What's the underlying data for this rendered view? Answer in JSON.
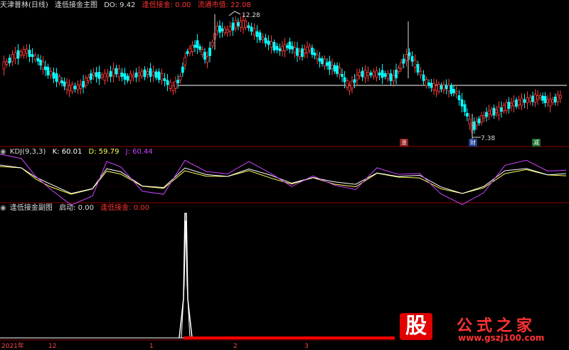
{
  "main_header": {
    "title": "天津普林(日线)",
    "indicator": "逢低接金主图",
    "do_label": "DO:",
    "do_value": "9.42",
    "fdjj_label": "逢低接金:",
    "fdjj_value": "0.00",
    "mkt_label": "流通市值:",
    "mkt_value": "22.08"
  },
  "kdj_header": {
    "name": "KDJ(9,3,3)",
    "k_label": "K:",
    "k_value": "60.01",
    "d_label": "D:",
    "d_value": "59.79",
    "j_label": "J:",
    "j_value": "60.44"
  },
  "sub_header": {
    "title": "逢低接金副图",
    "qd_label": "启动:",
    "qd_value": "0.00",
    "fdjj_label": "逢低接金:",
    "fdjj_value": "0.00"
  },
  "price_labels": {
    "high": "12.28",
    "low": "7.38"
  },
  "tags": {
    "zhang": "涨",
    "cai": "财",
    "jian": "减"
  },
  "date_axis": [
    "2021年",
    "12",
    "1",
    "2",
    "3"
  ],
  "logo": {
    "glyph": "股",
    "text": "公式之家",
    "url": "www.gszj100.com"
  },
  "colors": {
    "up": "#ff3b3b",
    "down": "#00ffff",
    "k": "#ffffff",
    "d": "#ffff55",
    "j": "#cc44ff",
    "label_red": "#ff3333"
  }
}
